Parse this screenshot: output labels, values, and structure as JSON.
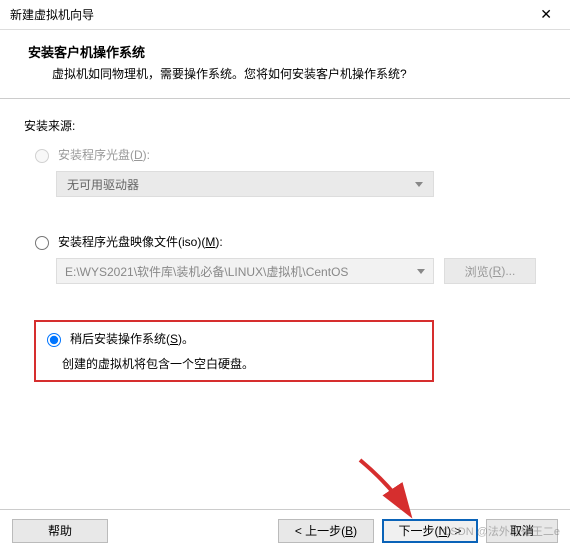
{
  "window": {
    "title": "新建虚拟机向导"
  },
  "header": {
    "heading": "安装客户机操作系统",
    "subheading": "虚拟机如同物理机，需要操作系统。您将如何安装客户机操作系统?"
  },
  "content": {
    "source_label": "安装来源:",
    "opt_disc": {
      "prefix": "安装程序光盘(",
      "key": "D",
      "suffix": "):",
      "drive_placeholder": "无可用驱动器"
    },
    "opt_iso": {
      "prefix": "安装程序光盘映像文件(iso)(",
      "key": "M",
      "suffix": "):",
      "path_value": "E:\\WYS2021\\软件库\\装机必备\\LINUX\\虚拟机\\CentOS",
      "browse_prefix": "浏览(",
      "browse_key": "R",
      "browse_suffix": ")..."
    },
    "opt_later": {
      "prefix": "稍后安装操作系统(",
      "key": "S",
      "suffix": ")。",
      "hint": "创建的虚拟机将包含一个空白硬盘。"
    }
  },
  "footer": {
    "help": "帮助",
    "back_prefix": "< 上一步(",
    "back_key": "B",
    "back_suffix": ")",
    "next_prefix": "下一步(",
    "next_key": "N",
    "next_suffix": ") >",
    "cancel": "取消"
  },
  "watermark": "CSDN @法外狂徒王二e"
}
